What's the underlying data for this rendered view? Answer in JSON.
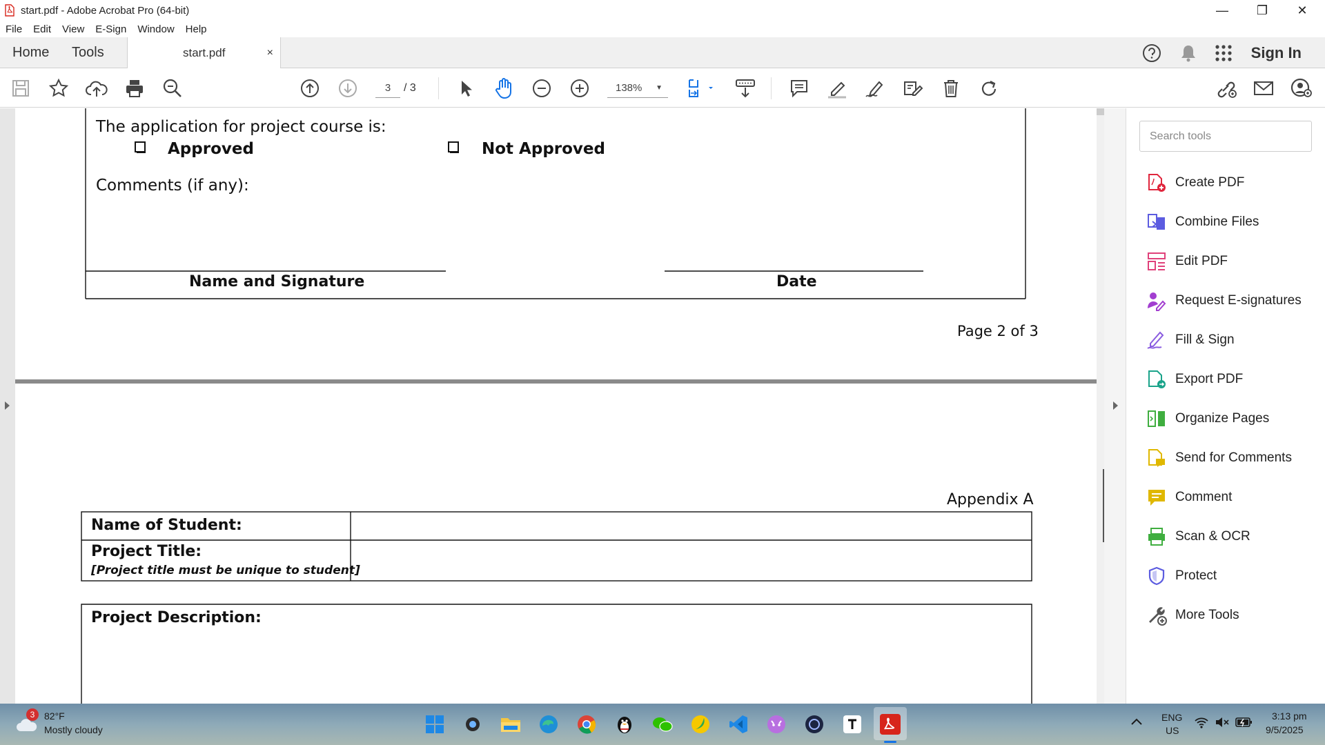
{
  "window": {
    "title": "start.pdf - Adobe Acrobat Pro (64-bit)",
    "minimize": "—",
    "restore": "❐",
    "close": "✕"
  },
  "menu": [
    "File",
    "Edit",
    "View",
    "E-Sign",
    "Window",
    "Help"
  ],
  "tabs": {
    "home": "Home",
    "tools": "Tools",
    "document": "start.pdf",
    "close_tab": "×",
    "sign_in": "Sign In"
  },
  "toolbar": {
    "current_page": "3",
    "page_total": "/ 3",
    "zoom": "138%"
  },
  "document": {
    "page2": {
      "application_prompt": "The application for project course is:",
      "approved": "Approved",
      "not_approved": "Not Approved",
      "comments": "Comments (if any):",
      "signature_label": "Name and Signature",
      "date_label": "Date",
      "page_footer": "Page 2 of 3"
    },
    "page3": {
      "appendix": "Appendix A",
      "name_of_student": "Name of Student:",
      "project_title": "Project Title:",
      "project_title_note": "[Project title must be unique to student]",
      "project_description": "Project Description:"
    }
  },
  "tools_panel": {
    "search_placeholder": "Search tools",
    "items": [
      {
        "label": "Create PDF",
        "color": "#e0263d"
      },
      {
        "label": "Combine Files",
        "color": "#5c5ce0"
      },
      {
        "label": "Edit PDF",
        "color": "#e0417a"
      },
      {
        "label": "Request E-signatures",
        "color": "#a23ed0"
      },
      {
        "label": "Fill & Sign",
        "color": "#8a5ce0"
      },
      {
        "label": "Export PDF",
        "color": "#1aa38a"
      },
      {
        "label": "Organize Pages",
        "color": "#3fae3f"
      },
      {
        "label": "Send for Comments",
        "color": "#e0b800"
      },
      {
        "label": "Comment",
        "color": "#e0b800"
      },
      {
        "label": "Scan & OCR",
        "color": "#3fae3f"
      },
      {
        "label": "Protect",
        "color": "#5c5ce0"
      },
      {
        "label": "More Tools",
        "color": "#555555"
      }
    ]
  },
  "taskbar": {
    "weather_temp": "82°F",
    "weather_desc": "Mostly cloudy",
    "weather_badge": "3",
    "lang_top": "ENG",
    "lang_bottom": "US",
    "time": "3:13 pm",
    "date": "9/5/2025"
  },
  "colors": {
    "accent_blue": "#1473e6",
    "acrobat_red": "#d7251b"
  }
}
